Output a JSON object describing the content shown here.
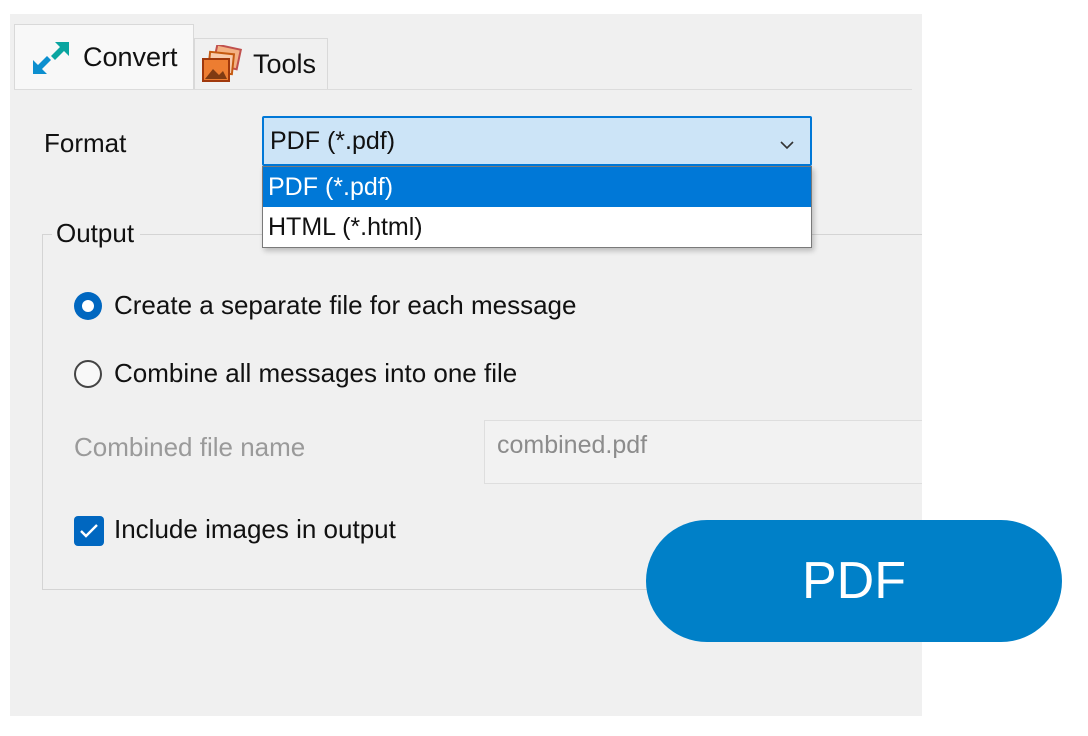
{
  "tabs": [
    {
      "label": "Convert",
      "icon": "arrows-diagonal-icon",
      "active": true
    },
    {
      "label": "Tools",
      "icon": "images-stack-icon",
      "active": false
    }
  ],
  "format": {
    "label": "Format",
    "selected": "PDF (*.pdf)",
    "options": [
      "PDF (*.pdf)",
      "HTML (*.html)"
    ],
    "highlighted_index": 0
  },
  "output": {
    "title": "Output",
    "option_separate": "Create a separate file for each message",
    "option_combine": "Combine all messages into one file",
    "selected_option": "separate",
    "combined_label": "Combined file name",
    "combined_value": "combined.pdf",
    "include_images_label": "Include images in output",
    "include_images_checked": true
  },
  "badge": {
    "text": "PDF"
  },
  "colors": {
    "accent": "#0078d7",
    "combo_bg": "#cce4f7",
    "badge": "#0080c8",
    "window_bg": "#f0f0f0"
  }
}
